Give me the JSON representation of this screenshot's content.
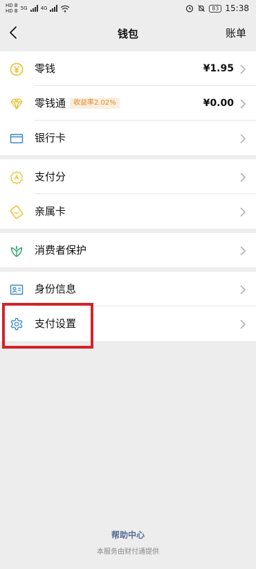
{
  "status_bar": {
    "carrier_left_1": "HD B",
    "carrier_left_2": "HD B",
    "net_1": "5G",
    "net_2": "4G",
    "battery": "83",
    "time": "15:38"
  },
  "nav": {
    "title": "钱包",
    "right_label": "账单"
  },
  "groups": {
    "g1": [
      {
        "label": "零钱",
        "value": "¥1.95"
      },
      {
        "label": "零钱通",
        "badge": "收益率2.02%",
        "value": "¥0.00"
      },
      {
        "label": "银行卡"
      }
    ],
    "g2": [
      {
        "label": "支付分"
      },
      {
        "label": "亲属卡"
      }
    ],
    "g3": [
      {
        "label": "消费者保护"
      }
    ],
    "g4": [
      {
        "label": "身份信息"
      },
      {
        "label": "支付设置"
      }
    ]
  },
  "footer": {
    "help_label": "帮助中心",
    "note": "本服务由财付通提供"
  },
  "colors": {
    "accent_yellow": "#e8c22a",
    "accent_blue": "#3a88c9",
    "accent_green": "#2fa36b",
    "highlight_red": "#d2232a",
    "link_blue": "#576b95"
  }
}
